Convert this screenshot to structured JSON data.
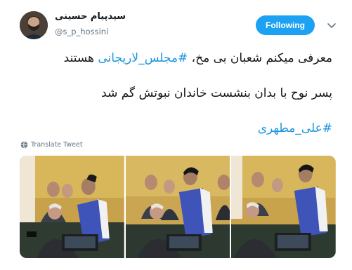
{
  "author": {
    "display_name": "سیدپیام حسینی",
    "handle": "@s_p_hossini"
  },
  "follow_button": {
    "label": "Following"
  },
  "tweet": {
    "line1_text": "معرفی میکنم شعبان بی مخ، ",
    "line1_hashtag": "#مجلس_لاریجانی",
    "line1_suffix": " هستند",
    "line2_text": "پسر نوح با بدان بنشست خاندان نبوتش گم شد",
    "line3_hashtag": "#علی_مطهری"
  },
  "translate_link": {
    "label": "Translate Tweet"
  },
  "colors": {
    "accent": "#1da1f2",
    "hashtag": "#1b95e0",
    "muted": "#657786"
  },
  "photos": [
    {
      "name": "photo-1"
    },
    {
      "name": "photo-2"
    },
    {
      "name": "photo-3"
    }
  ]
}
